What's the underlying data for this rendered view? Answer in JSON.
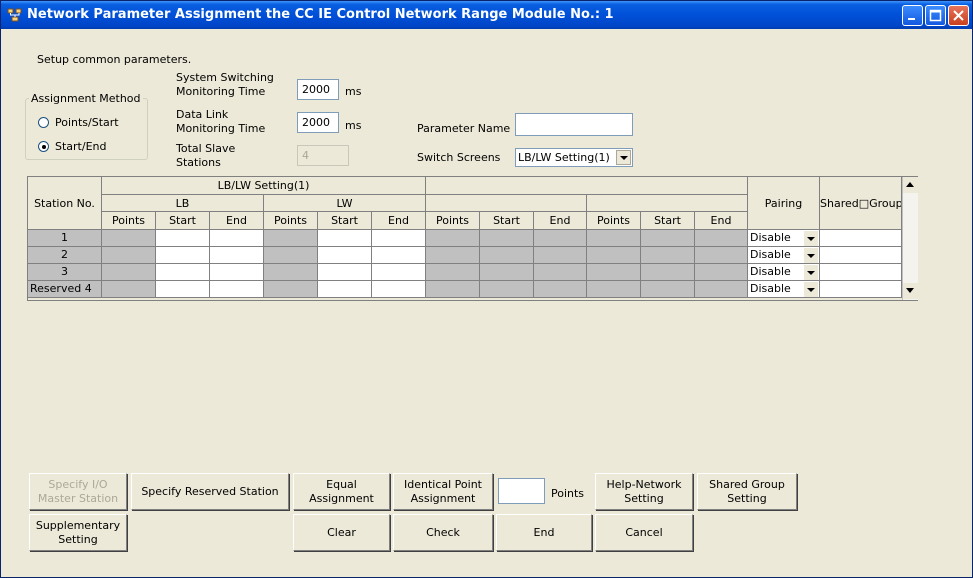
{
  "window": {
    "title": "Network Parameter  Assignment the CC IE Control Network Range Module No.: 1"
  },
  "header": {
    "instruction": "Setup common parameters.",
    "assignment_method": {
      "label": "Assignment Method",
      "options": [
        "Points/Start",
        "Start/End"
      ],
      "selected": "Start/End"
    },
    "system_switching_label": "System Switching Monitoring Time",
    "system_switching_value": "2000",
    "data_link_label": "Data Link Monitoring Time",
    "data_link_value": "2000",
    "unit_ms": "ms",
    "total_slave_label": "Total Slave Stations",
    "total_slave_value": "4",
    "parameter_name_label": "Parameter Name",
    "parameter_name_value": "",
    "switch_screens_label": "Switch Screens",
    "switch_screens_value": "LB/LW Setting(1)"
  },
  "grid": {
    "station_header": "Station No.",
    "group1_header": "LB/LW Setting(1)",
    "lb_header": "LB",
    "lw_header": "LW",
    "sub_headers": [
      "Points",
      "Start",
      "End"
    ],
    "pairing_header": "Pairing",
    "shared_group_header": "Shared□Group",
    "rows": [
      {
        "station": "1",
        "pairing": "Disable"
      },
      {
        "station": "2",
        "pairing": "Disable"
      },
      {
        "station": "3",
        "pairing": "Disable"
      },
      {
        "station": "Reserved  4",
        "pairing": "Disable"
      }
    ]
  },
  "buttons": {
    "specify_io_master": "Specify I/O Master Station",
    "specify_reserved": "Specify Reserved Station",
    "equal_assignment": "Equal Assignment",
    "identical_point": "Identical Point Assignment",
    "points_value": "",
    "points_label": "Points",
    "help_network": "Help-Network Setting",
    "shared_group_setting": "Shared Group Setting",
    "supplementary": "Supplementary Setting",
    "clear": "Clear",
    "check": "Check",
    "end": "End",
    "cancel": "Cancel"
  }
}
